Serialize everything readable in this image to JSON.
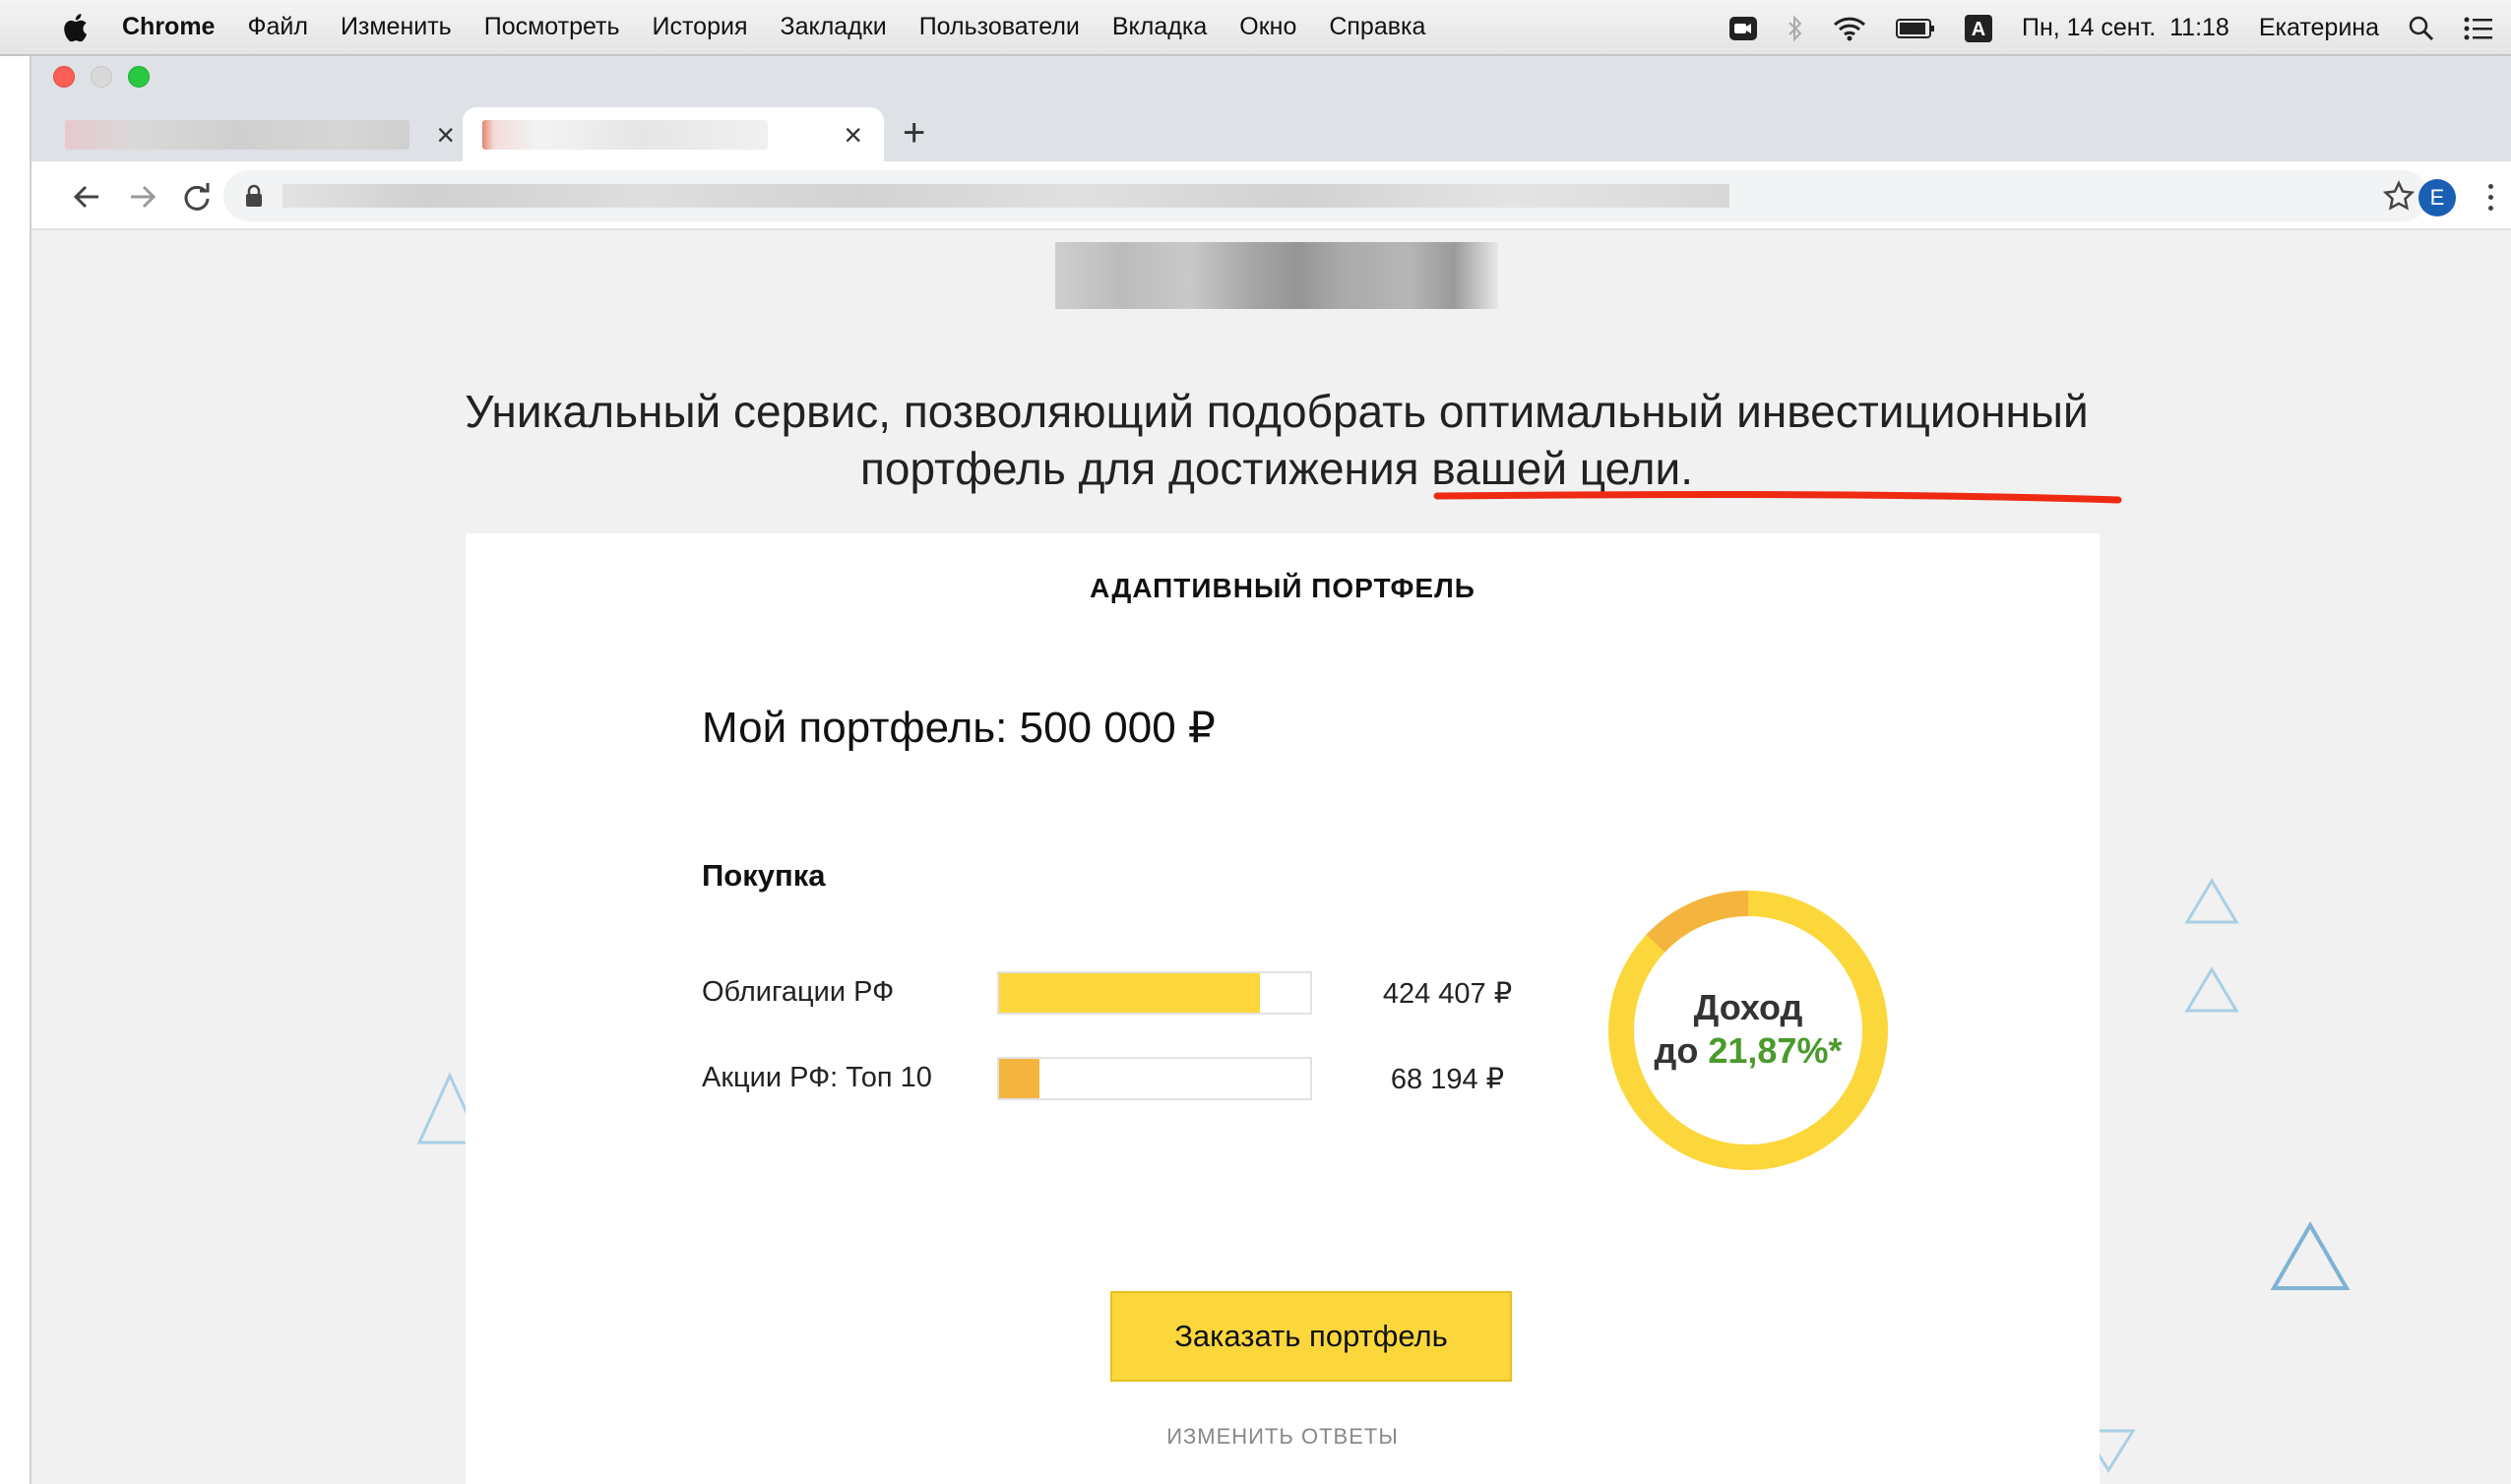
{
  "menubar": {
    "app": "Chrome",
    "items": [
      "Файл",
      "Изменить",
      "Посмотреть",
      "История",
      "Закладки",
      "Пользователи",
      "Вкладка",
      "Окно",
      "Справка"
    ],
    "datetime": "Пн, 14 сент.  11:18",
    "user": "Екатерина",
    "input_indicator": "A"
  },
  "browser": {
    "profile_initial": "E",
    "new_tab_label": "+",
    "tab_close_label": "×"
  },
  "page": {
    "headline_part1": "Уникальный сервис, позволяющий подобрать ",
    "headline_highlight1": "оптимальный инвестиционный",
    "headline_highlight2": "портфель для достижения вашей цели.",
    "card_title": "АДАПТИВНЫЙ ПОРТФЕЛЬ",
    "portfolio_label": "Мой портфель: 500 000 ₽",
    "purchase_label": "Покупка",
    "assets": [
      {
        "name": "Облигации РФ",
        "amount": "424 407 ₽",
        "share": 0.84,
        "color": "#fcd73b"
      },
      {
        "name": "Акции РФ: Топ 10",
        "amount": "68 194 ₽",
        "share": 0.13,
        "color": "#f4b53f"
      }
    ],
    "income_label": "Доход",
    "income_prefix": "до ",
    "income_value": "21,87%*",
    "cta_label": "Заказать портфель",
    "change_answers": "ИЗМЕНИТЬ ОТВЕТЫ"
  },
  "colors": {
    "accent_yellow": "#fcd73b",
    "accent_orange": "#f4b53f",
    "income_green": "#4a9a2c",
    "annotation_red": "#ee2a12",
    "deco_blue": "#a9cfe4"
  }
}
